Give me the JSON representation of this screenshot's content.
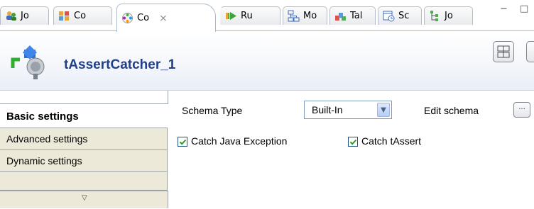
{
  "tabs": [
    {
      "label": "Jo",
      "icon": "job-icon",
      "active": false
    },
    {
      "label": "Co",
      "icon": "contexts-icon",
      "active": false
    },
    {
      "label": "Co",
      "icon": "component-icon",
      "active": true
    },
    {
      "label": "Ru",
      "icon": "run-icon",
      "active": false
    },
    {
      "label": "Mo",
      "icon": "modules-icon",
      "active": false
    },
    {
      "label": "Tal",
      "icon": "talend-exchange-icon",
      "active": false
    },
    {
      "label": "Sc",
      "icon": "scheduler-icon",
      "active": false
    },
    {
      "label": "Jo",
      "icon": "job-hierarchy-icon",
      "active": false
    }
  ],
  "window": {
    "minimize_icon": "minimize-icon",
    "maximize_icon": "maximize-icon"
  },
  "component": {
    "title": "tAssertCatcher_1",
    "icon": "tassertcatcher-component-icon"
  },
  "sidebar": {
    "items": [
      {
        "label": "Basic settings",
        "selected": true
      },
      {
        "label": "Advanced settings",
        "selected": false
      },
      {
        "label": "Dynamic settings",
        "selected": false
      }
    ],
    "scroll_icon": "scroll-down-triangle-icon"
  },
  "basic": {
    "schema_type_label": "Schema Type",
    "schema_type_value": "Built-In",
    "edit_schema_label": "Edit schema",
    "edit_schema_button": "...",
    "catch_java_exception_label": "Catch Java Exception",
    "catch_java_exception_checked": true,
    "catch_tassert_label": "Catch tAssert",
    "catch_tassert_checked": true
  },
  "colors": {
    "title": "#1f3f8a",
    "header_bg": "#f5f7fb",
    "sidebar_bg": "#ece9d8",
    "checkbox_check": "#21a121"
  }
}
